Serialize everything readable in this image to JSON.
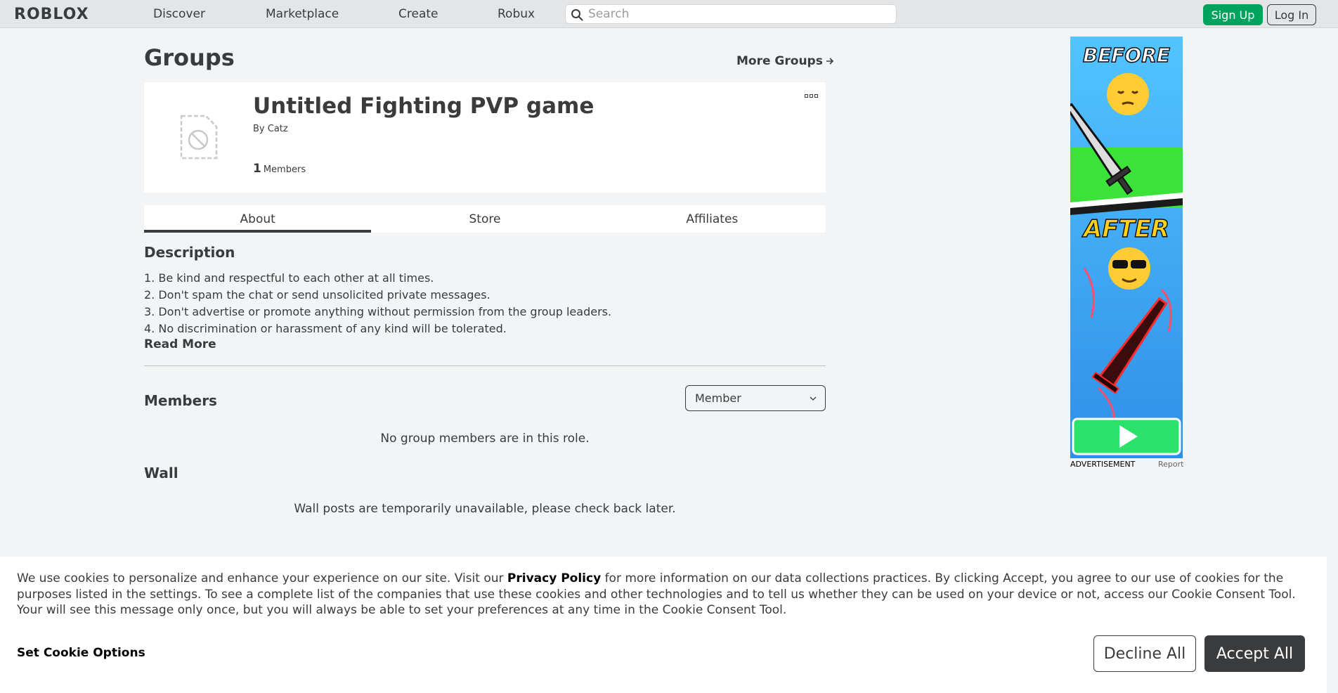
{
  "nav": {
    "logo": "ROBLOX",
    "links": [
      "Discover",
      "Marketplace",
      "Create",
      "Robux"
    ],
    "search_placeholder": "Search",
    "signup_label": "Sign Up",
    "login_label": "Log In"
  },
  "header": {
    "title": "Groups",
    "more_groups": "More Groups"
  },
  "group": {
    "name": "Untitled Fighting PVP game",
    "by_label": "By",
    "owner": "Catz",
    "member_count": "1",
    "members_label": "Members"
  },
  "tabs": [
    "About",
    "Store",
    "Affiliates"
  ],
  "description": {
    "title": "Description",
    "lines": [
      "1. Be kind and respectful to each other at all times.",
      "2. Don't spam the chat or send unsolicited private messages.",
      "3. Don't advertise or promote anything without permission from the group leaders.",
      "4. No discrimination or harassment of any kind will be tolerated."
    ],
    "read_more": "Read More"
  },
  "members": {
    "title": "Members",
    "role_selected": "Member",
    "empty_text": "No group members are in this role."
  },
  "wall": {
    "title": "Wall",
    "empty_text": "Wall posts are temporarily unavailable, please check back later."
  },
  "ad": {
    "before_text": "BEFORE",
    "after_text": "AFTER",
    "label": "ADVERTISEMENT",
    "report": "Report"
  },
  "cookies": {
    "text_before": "We use cookies to personalize and enhance your experience on our site. Visit our ",
    "privacy_link": "Privacy Policy",
    "text_after": " for more information on our data collections practices. By clicking Accept, you agree to our use of cookies for the purposes listed in the settings. To see a complete list of the companies that use these cookies and other technologies and to tell us whether they can be used on your device or not, access our Cookie Consent Tool. Your will see this message only once, but you will always be able to set your preferences at any time in the Cookie Consent Tool.",
    "options_label": "Set Cookie Options",
    "decline_label": "Decline All",
    "accept_label": "Accept All"
  },
  "colors": {
    "signup_green": "#00a35e",
    "accept_dark": "#393b3d",
    "page_bg": "#f2f4f5"
  }
}
